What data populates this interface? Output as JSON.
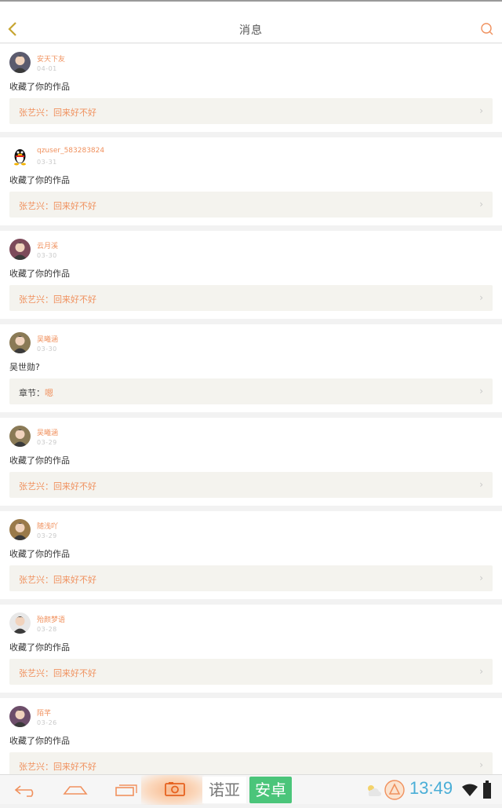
{
  "header": {
    "title": "消息"
  },
  "items": [
    {
      "user": "安天下友",
      "date": "04-01",
      "message": "收藏了你的作品",
      "work": "张艺兴：回来好不好",
      "prefix": "",
      "avatar": "avatar-photo"
    },
    {
      "user": "qzuser_583283824",
      "date": "03-31",
      "message": "收藏了你的作品",
      "work": "张艺兴：回来好不好",
      "prefix": "",
      "avatar": "qq-penguin"
    },
    {
      "user": "云月溪",
      "date": "03-30",
      "message": "收藏了你的作品",
      "work": "张艺兴：回来好不好",
      "prefix": "",
      "avatar": "avatar-photo"
    },
    {
      "user": "吴曦涵",
      "date": "03-30",
      "message": "吴世勋?",
      "work": "嗯",
      "prefix": "章节：",
      "avatar": "avatar-photo"
    },
    {
      "user": "吴曦涵",
      "date": "03-29",
      "message": "收藏了你的作品",
      "work": "张艺兴：回来好不好",
      "prefix": "",
      "avatar": "avatar-photo"
    },
    {
      "user": "随浅吖",
      "date": "03-29",
      "message": "收藏了你的作品",
      "work": "张艺兴：回来好不好",
      "prefix": "",
      "avatar": "avatar-photo"
    },
    {
      "user": "殆颜梦语",
      "date": "03-28",
      "message": "收藏了你的作品",
      "work": "张艺兴：回来好不好",
      "prefix": "",
      "avatar": "avatar-photo"
    },
    {
      "user": "陌芊",
      "date": "03-26",
      "message": "收藏了你的作品",
      "work": "张艺兴：回来好不好",
      "prefix": "",
      "avatar": "avatar-photo"
    }
  ],
  "navbar": {
    "tag1": "诺亚",
    "tag2": "安卓",
    "time": "13:49"
  },
  "colors": {
    "accent": "#f0915e",
    "nav_green": "#4bc57a",
    "clock": "#4aaed7"
  }
}
